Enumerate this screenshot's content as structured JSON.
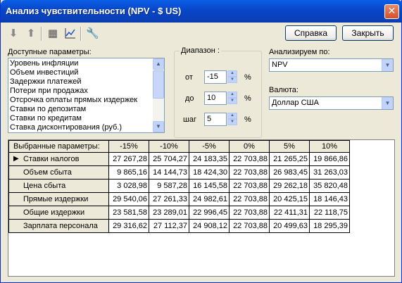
{
  "window": {
    "title": "Анализ чувствительности (NPV - $ US)",
    "close": "✕"
  },
  "toolbar": {
    "icons": [
      "download-icon",
      "upload-icon",
      "copy-grid-icon",
      "chart-icon",
      "wrench-icon"
    ]
  },
  "buttons": {
    "help": "Справка",
    "close": "Закрыть"
  },
  "params": {
    "label": "Доступные параметры:",
    "items": [
      "Уровень инфляции",
      "Объем инвестиций",
      "Задержки платежей",
      "Потери при продажах",
      "Отсрочка оплаты прямых издержек",
      "Ставки по депозитам",
      "Ставки по кредитам",
      "Ставка дисконтирования (руб.)"
    ]
  },
  "range": {
    "title": "Диапазон :",
    "from_label": "от",
    "from_value": "-15",
    "to_label": "до",
    "to_value": "10",
    "step_label": "шаг",
    "step_value": "5",
    "unit": "%"
  },
  "analyze": {
    "label": "Анализируем по:",
    "value": "NPV"
  },
  "currency": {
    "label": "Валюта:",
    "value": "Доллар США"
  },
  "table": {
    "corner": "Выбранные параметры:",
    "columns": [
      "-15%",
      "-10%",
      "-5%",
      "0%",
      "5%",
      "10%"
    ],
    "rows": [
      {
        "name": "Ставки налогов",
        "values": [
          "27 267,28",
          "25 704,27",
          "24 183,35",
          "22 703,88",
          "21 265,25",
          "19 866,86"
        ]
      },
      {
        "name": "Объем сбыта",
        "values": [
          "9 865,16",
          "14 144,73",
          "18 424,30",
          "22 703,88",
          "26 983,45",
          "31 263,03"
        ]
      },
      {
        "name": "Цена сбыта",
        "values": [
          "3 028,98",
          "9 587,28",
          "16 145,58",
          "22 703,88",
          "29 262,18",
          "35 820,48"
        ]
      },
      {
        "name": "Прямые издержки",
        "values": [
          "29 540,06",
          "27 261,33",
          "24 982,61",
          "22 703,88",
          "20 425,15",
          "18 146,43"
        ]
      },
      {
        "name": "Общие издержки",
        "values": [
          "23 581,58",
          "23 289,01",
          "22 996,45",
          "22 703,88",
          "22 411,31",
          "22 118,75"
        ]
      },
      {
        "name": "Зарплата персонала",
        "values": [
          "29 316,62",
          "27 112,37",
          "24 908,12",
          "22 703,88",
          "20 499,63",
          "18 295,39"
        ]
      }
    ]
  }
}
